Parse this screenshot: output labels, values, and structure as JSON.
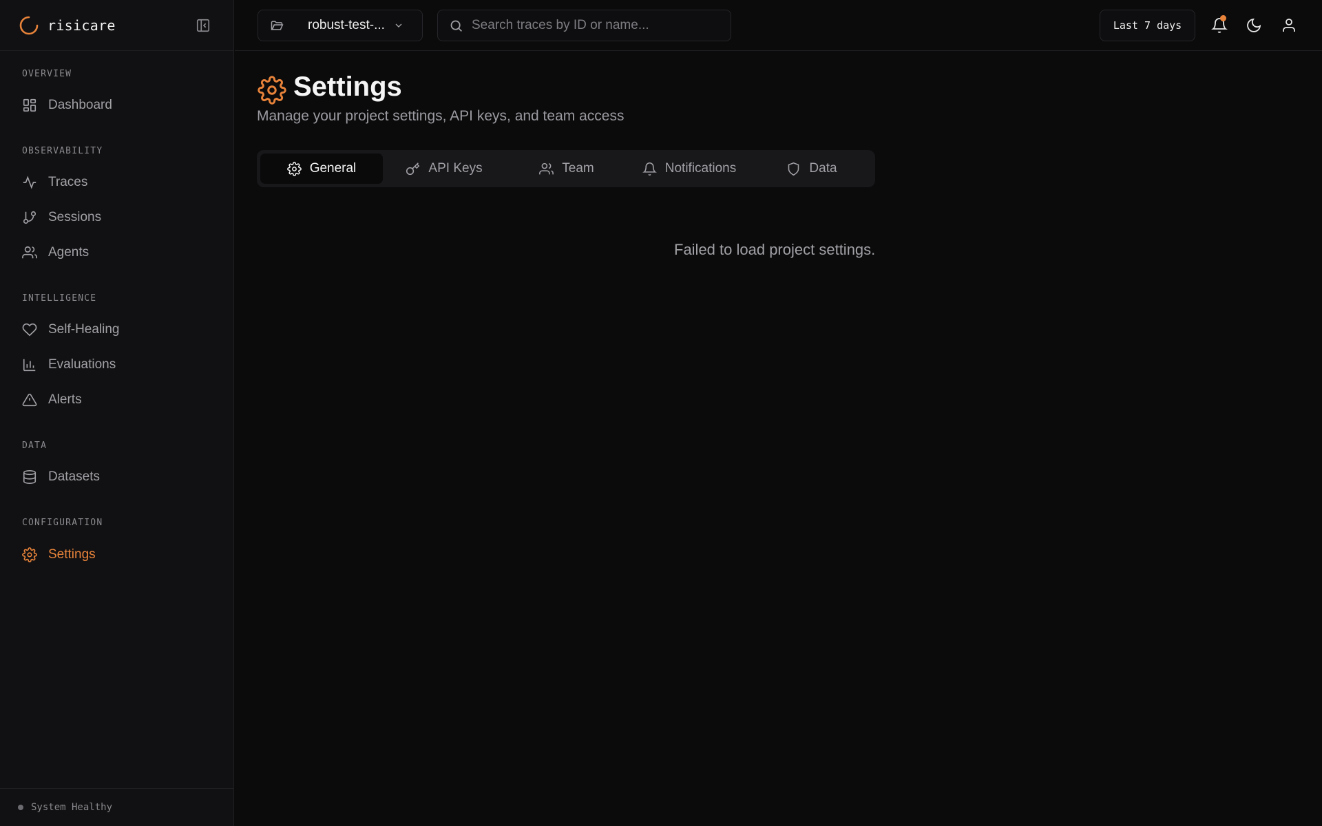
{
  "brand": {
    "name": "risicare",
    "accent": "#e8833a"
  },
  "sidebar": {
    "sections": [
      {
        "title": "OVERVIEW",
        "items": [
          {
            "label": "Dashboard",
            "icon": "grid-icon"
          }
        ]
      },
      {
        "title": "OBSERVABILITY",
        "items": [
          {
            "label": "Traces",
            "icon": "activity-icon"
          },
          {
            "label": "Sessions",
            "icon": "branch-icon"
          },
          {
            "label": "Agents",
            "icon": "users-icon"
          }
        ]
      },
      {
        "title": "INTELLIGENCE",
        "items": [
          {
            "label": "Self-Healing",
            "icon": "heart-icon"
          },
          {
            "label": "Evaluations",
            "icon": "bar-chart-icon"
          },
          {
            "label": "Alerts",
            "icon": "alert-triangle-icon"
          }
        ]
      },
      {
        "title": "DATA",
        "items": [
          {
            "label": "Datasets",
            "icon": "database-icon"
          }
        ]
      },
      {
        "title": "CONFIGURATION",
        "items": [
          {
            "label": "Settings",
            "icon": "gear-icon",
            "active": true
          }
        ]
      }
    ],
    "status": "System Healthy"
  },
  "header": {
    "project": "robust-test-...",
    "search_placeholder": "Search traces by ID or name...",
    "time_range": "Last 7 days"
  },
  "main": {
    "title": "Settings",
    "subtitle": "Manage your project settings, API keys, and team access",
    "tabs": [
      {
        "label": "General",
        "icon": "gear-icon",
        "active": true
      },
      {
        "label": "API Keys",
        "icon": "key-icon"
      },
      {
        "label": "Team",
        "icon": "users-icon"
      },
      {
        "label": "Notifications",
        "icon": "bell-icon"
      },
      {
        "label": "Data",
        "icon": "shield-icon"
      }
    ],
    "error": "Failed to load project settings."
  }
}
